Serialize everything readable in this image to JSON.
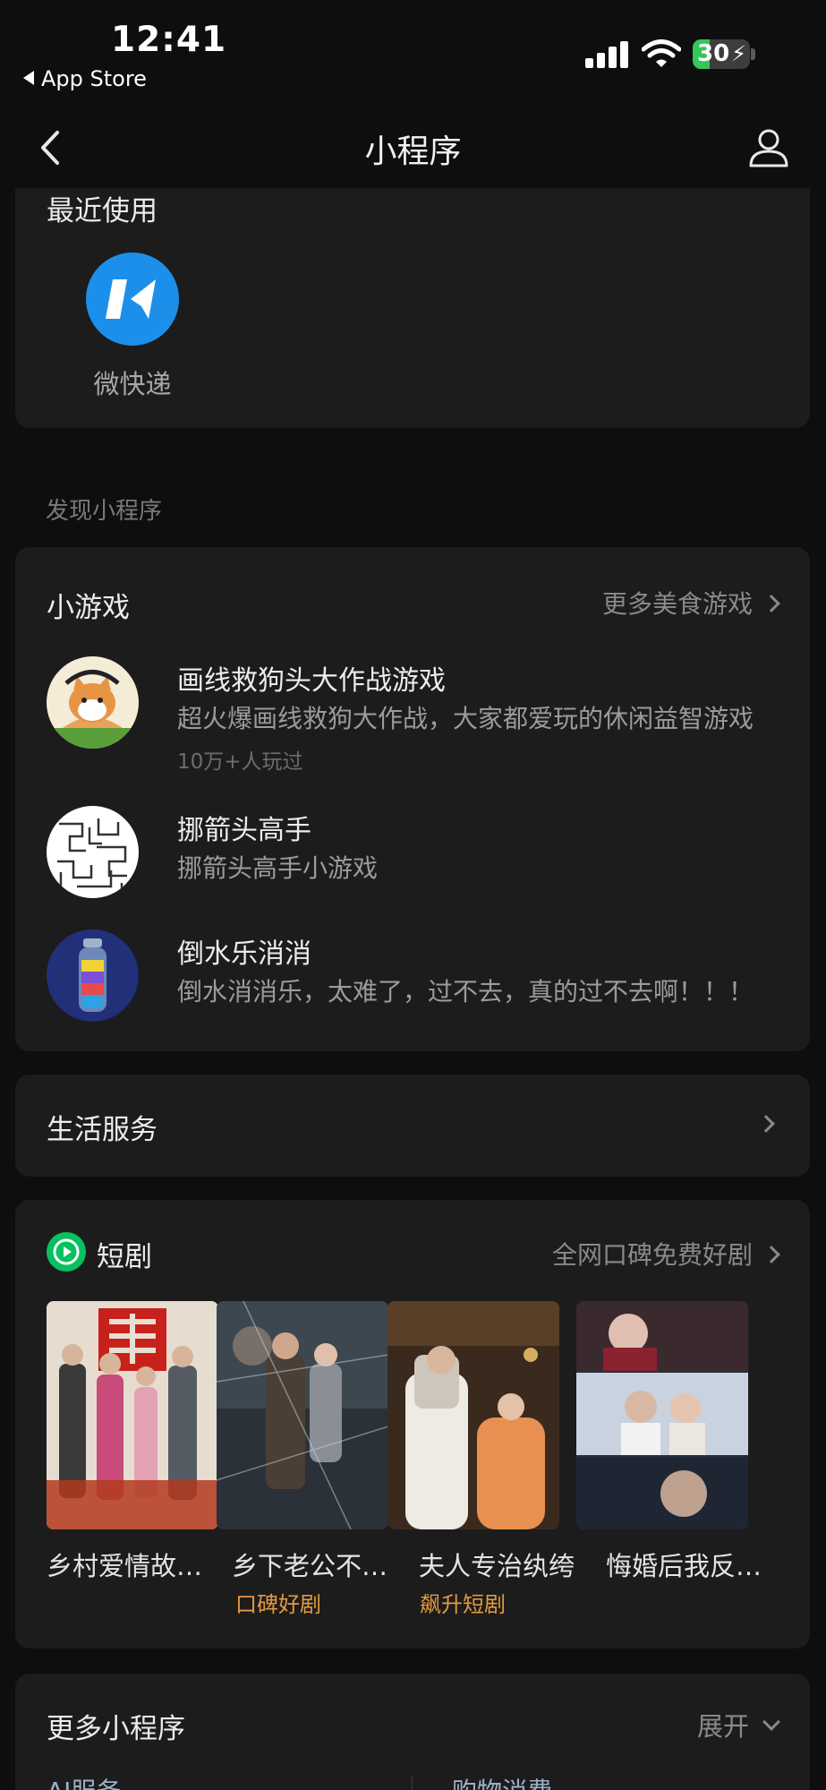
{
  "status_bar": {
    "time": "12:41",
    "back_app": "App Store",
    "battery": "30",
    "battery_level": 0.3
  },
  "nav": {
    "title": "小程序"
  },
  "recent": {
    "title": "最近使用",
    "items": [
      {
        "label": "微快递",
        "icon": "kuaidi-icon"
      }
    ]
  },
  "discover_label": "发现小程序",
  "games": {
    "title": "小游戏",
    "more": "更多美食游戏",
    "items": [
      {
        "name": "画线救狗头大作战游戏",
        "desc": "超火爆画线救狗大作战，大家都爱玩的休闲益智游戏",
        "meta": "10万+人玩过"
      },
      {
        "name": "挪箭头高手",
        "desc": "挪箭头高手小游戏"
      },
      {
        "name": "倒水乐消消",
        "desc": "倒水消消乐，太难了，过不去，真的过不去啊！！！"
      }
    ]
  },
  "life": {
    "title": "生活服务"
  },
  "drama": {
    "title": "短剧",
    "more": "全网口碑免费好剧",
    "items": [
      {
        "name": "乡村爱情故事多",
        "tag": "",
        "poster_text": "乡村爱情故事多"
      },
      {
        "name": "乡下老公不好惹",
        "tag": "口碑好剧",
        "poster_text": "乡下老公不好惹"
      },
      {
        "name": "夫人专治纨绔",
        "tag": "飙升短剧",
        "poster_text": "夫人专治纨绔"
      },
      {
        "name": "悔婚后我反手嫁给前任老公",
        "tag": "",
        "poster_text": "悔婚后我反手嫁给前任老公"
      }
    ]
  },
  "more_programs": {
    "title": "更多小程序",
    "expand": "展开",
    "categories": [
      "AI服务",
      "购物消费"
    ]
  }
}
